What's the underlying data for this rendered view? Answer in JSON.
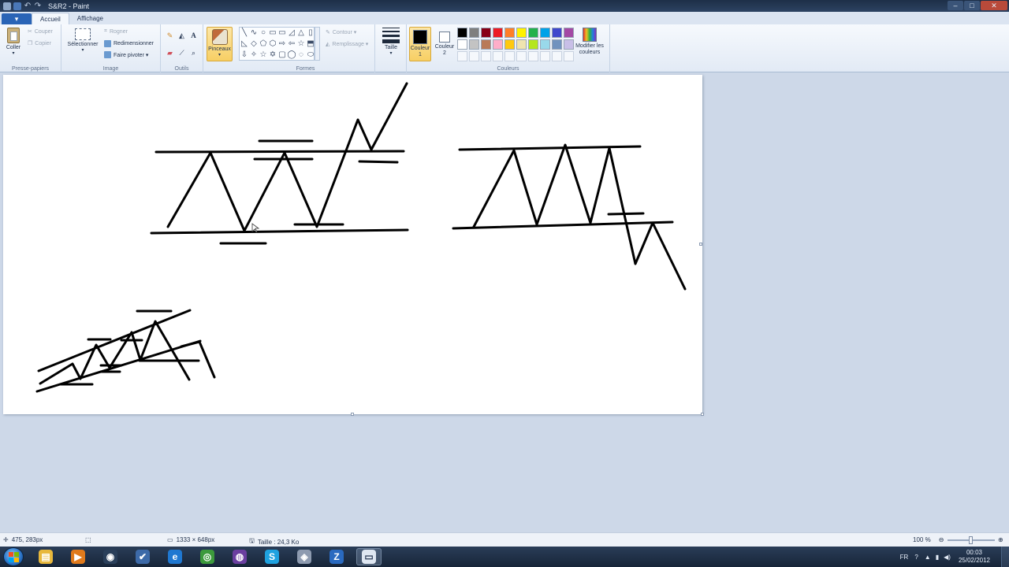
{
  "window": {
    "title": "S&R2 - Paint",
    "controls": [
      "–",
      "□",
      "✕"
    ]
  },
  "tabs": {
    "file_icon": "▾",
    "home": "Accueil",
    "view": "Affichage"
  },
  "ribbon": {
    "clipboard": {
      "label": "Presse-papiers",
      "paste": "Coller",
      "cut": "Couper",
      "copy": "Copier"
    },
    "image": {
      "label": "Image",
      "select": "Sélectionner",
      "crop": "Rogner",
      "resize": "Redimensionner",
      "rotate": "Faire pivoter ▾"
    },
    "tools": {
      "label": "Outils",
      "text_glyph": "A"
    },
    "brushes": {
      "label": "Pinceaux"
    },
    "shapes": {
      "label": "Formes",
      "outline": "Contour ▾",
      "fill": "Remplissage ▾",
      "glyphs": [
        "╲",
        "∿",
        "○",
        "▭",
        "▭",
        "◿",
        "△",
        "▯",
        "◺",
        "◇",
        "⬠",
        "⬡",
        "⇨",
        "⇦",
        "☆",
        "⬒",
        "⇩",
        "✧",
        "☆",
        "✡",
        "▢",
        "◯",
        "◌",
        "⬭"
      ]
    },
    "size": {
      "label": "Taille"
    },
    "colors": {
      "label": "Couleurs",
      "color1": "Couleur 1",
      "color2": "Couleur 2",
      "edit": "Modifier les couleurs",
      "color1_value": "#000000",
      "color2_value": "#ffffff",
      "palette": [
        "#000000",
        "#7f7f7f",
        "#880015",
        "#ed1c24",
        "#ff7f27",
        "#fff200",
        "#22b14c",
        "#00a2e8",
        "#3f48cc",
        "#a349a4",
        "#ffffff",
        "#c3c3c3",
        "#b97a57",
        "#ffaec9",
        "#ffc90e",
        "#efe4b0",
        "#b5e61d",
        "#99d9ea",
        "#7092be",
        "#c8bfe7"
      ]
    }
  },
  "status": {
    "cursor_pos": "475, 283px",
    "dimensions": "1333 × 648px",
    "file_size": "Taille : 24,3 Ko",
    "zoom": "100 %"
  },
  "taskbar": {
    "apps": [
      {
        "name": "explorer",
        "color": "#e8b83c",
        "glyph": "▤"
      },
      {
        "name": "media",
        "color": "#e07a1c",
        "glyph": "▶"
      },
      {
        "name": "tool-a",
        "color": "#2a3f5a",
        "glyph": "◉"
      },
      {
        "name": "tool-b",
        "color": "#3d6aa8",
        "glyph": "✔"
      },
      {
        "name": "ie",
        "color": "#1f78d1",
        "glyph": "e"
      },
      {
        "name": "chrome",
        "color": "#3c9a3c",
        "glyph": "◎"
      },
      {
        "name": "tool-c",
        "color": "#6b3fa0",
        "glyph": "◍"
      },
      {
        "name": "skype",
        "color": "#1fa2e0",
        "glyph": "S"
      },
      {
        "name": "tool-d",
        "color": "#8e9bb0",
        "glyph": "◈"
      },
      {
        "name": "tool-e",
        "color": "#2a6ac0",
        "glyph": "Z"
      },
      {
        "name": "paint",
        "color": "#dfe7f2",
        "glyph": "▭"
      }
    ],
    "lang": "FR",
    "time": "00:03",
    "date": "25/02/2012"
  },
  "colors": {
    "ribbon_active": "#f7cf64",
    "titlebar": "#1d2f47",
    "canvas": "#ffffff"
  }
}
